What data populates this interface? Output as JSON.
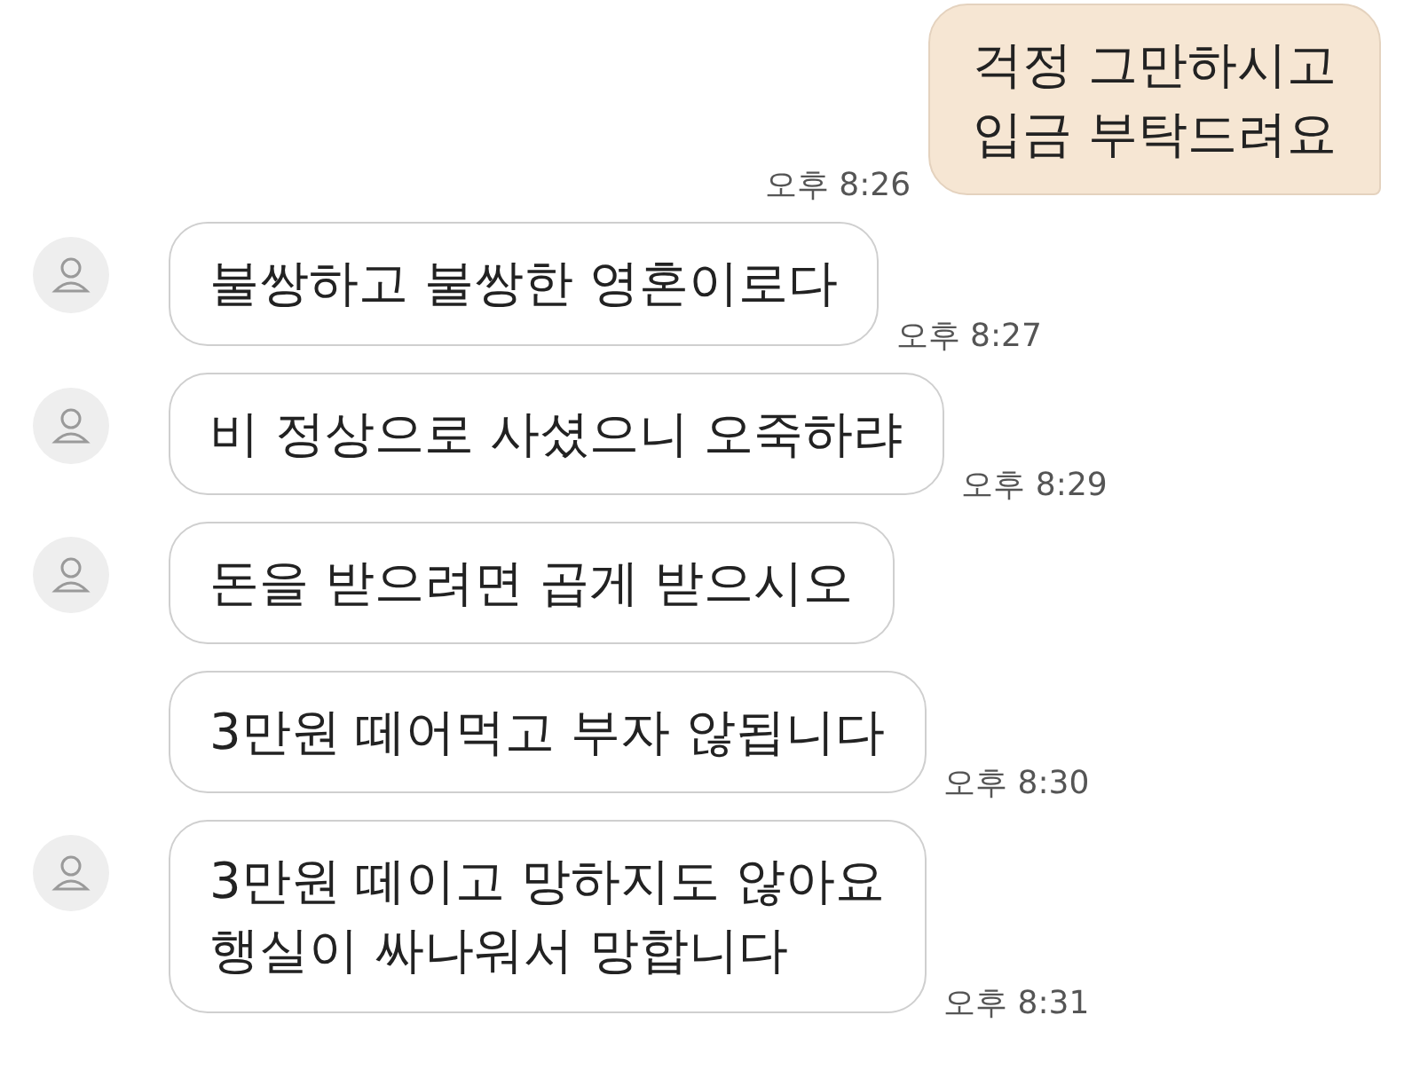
{
  "messages": [
    {
      "kind": "outgoing",
      "text": "걱정 그만하시고\n입금 부탁드려요",
      "time": "오후 8:26"
    },
    {
      "kind": "incoming",
      "show_avatar": true,
      "text": "불쌍하고 불쌍한 영혼이로다",
      "time": "오후 8:27"
    },
    {
      "kind": "incoming",
      "show_avatar": true,
      "text": "비 정상으로 사셨으니 오죽하랴",
      "time": "오후 8:29"
    },
    {
      "kind": "incoming",
      "show_avatar": true,
      "text": "돈을 받으려면 곱게 받으시오"
    },
    {
      "kind": "incoming",
      "show_avatar": false,
      "text": "3만원 떼어먹고 부자 않됩니다",
      "time": "오후 8:30"
    },
    {
      "kind": "incoming",
      "show_avatar": true,
      "text": "3만원 떼이고 망하지도 않아요\n행실이 싸나워서 망합니다",
      "time": "오후 8:31"
    }
  ]
}
